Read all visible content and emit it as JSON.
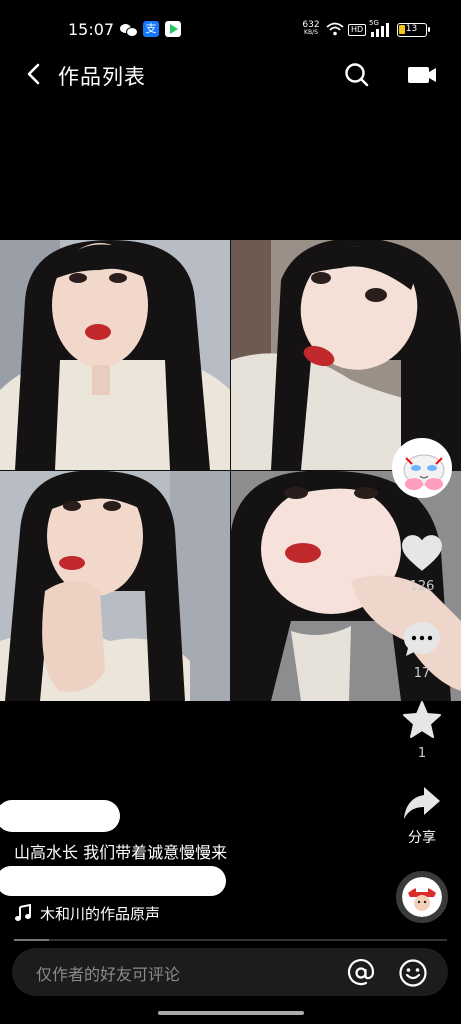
{
  "status_bar": {
    "time": "15:07",
    "net_speed_value": "632",
    "net_speed_unit": "KB/S",
    "hd": "HD",
    "signal_label": "5G",
    "battery": "13",
    "battery_color": "#f5c518",
    "app_icons": [
      "wechat-icon",
      "alipay-icon",
      "play-icon"
    ]
  },
  "header": {
    "title": "作品列表",
    "icons": [
      "back-icon",
      "search-icon",
      "camera-icon"
    ]
  },
  "actions": {
    "like_count": "126",
    "comment_count": "17",
    "favorite_count": "1",
    "share_label": "分享"
  },
  "caption": {
    "text": "山高水长 我们带着诚意慢慢来"
  },
  "music": {
    "title": "木和川的作品原声"
  },
  "progress": {
    "fraction": 0.08
  },
  "comment_bar": {
    "placeholder": "仅作者的好友可评论"
  },
  "alipay_glyph": "支",
  "colors": {
    "background": "#000000",
    "lips": "#c0282c",
    "comment_bar": "#1c1c1c"
  }
}
